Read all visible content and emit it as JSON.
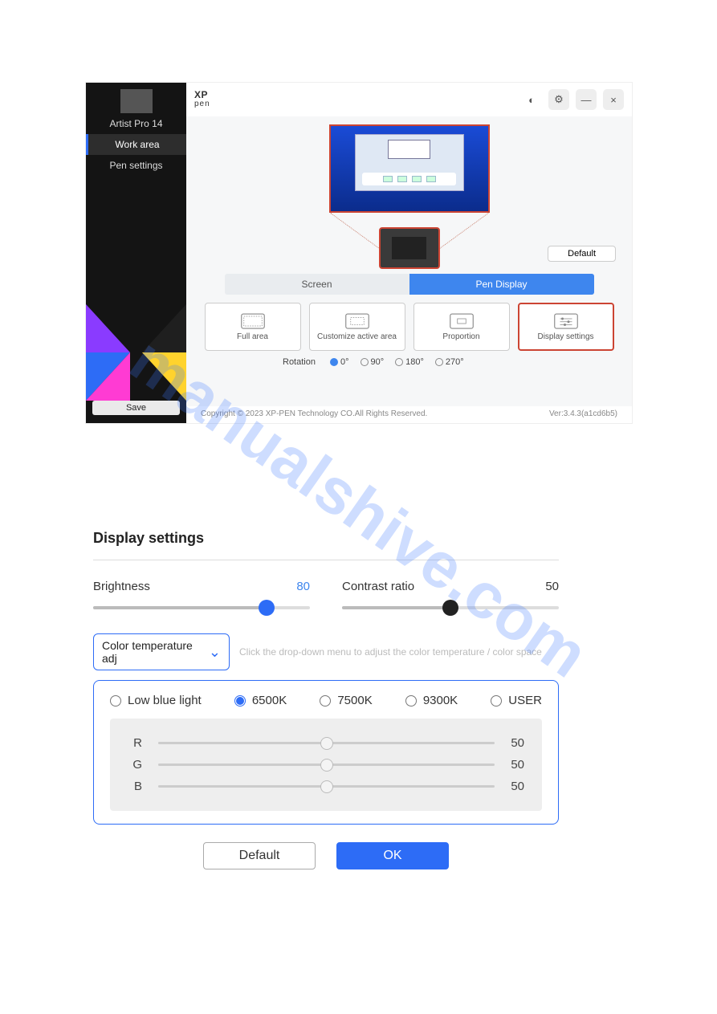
{
  "watermark": "manualshive.com",
  "app": {
    "logo_top": "XP",
    "logo_bottom": "pen",
    "titlebar_icons": {
      "theme": "◐",
      "settings": "⚙",
      "min": "—",
      "close": "×"
    },
    "sidebar": {
      "device": "Artist Pro 14",
      "items": [
        "Work area",
        "Pen settings"
      ],
      "active_index": 0,
      "save": "Save"
    },
    "default_btn": "Default",
    "tabs": {
      "items": [
        "Screen",
        "Pen Display"
      ],
      "active_index": 1
    },
    "options": [
      {
        "label": "Full area"
      },
      {
        "label": "Customize active area"
      },
      {
        "label": "Proportion"
      },
      {
        "label": "Display settings"
      }
    ],
    "options_selected_index": 3,
    "rotation": {
      "label": "Rotation",
      "options": [
        "0°",
        "90°",
        "180°",
        "270°"
      ],
      "selected_index": 0
    },
    "footer": {
      "copyright": "Copyright © 2023  XP-PEN Technology CO.All Rights Reserved.",
      "version": "Ver:3.4.3(a1cd6b5)"
    }
  },
  "dialog": {
    "title": "Display settings",
    "brightness": {
      "label": "Brightness",
      "value": 80
    },
    "contrast": {
      "label": "Contrast ratio",
      "value": 50
    },
    "dropdown": {
      "label": "Color temperature adj",
      "chevron": "⌄"
    },
    "hint": "Click the drop-down menu to adjust the color temperature / color space",
    "color_temps": [
      "Low blue light",
      "6500K",
      "7500K",
      "9300K",
      "USER"
    ],
    "color_temp_selected_index": 1,
    "rgb": {
      "R": 50,
      "G": 50,
      "B": 50
    },
    "buttons": {
      "default": "Default",
      "ok": "OK"
    }
  }
}
